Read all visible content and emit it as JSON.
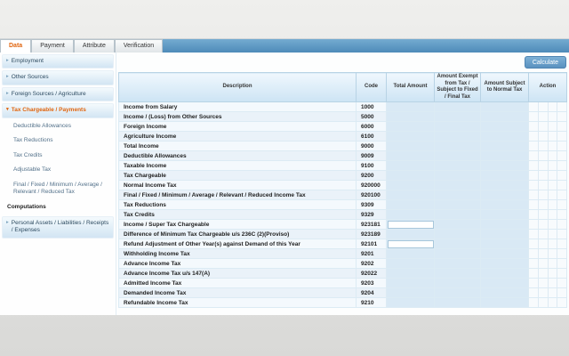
{
  "tabs": [
    {
      "label": "Data",
      "active": true
    },
    {
      "label": "Payment",
      "active": false
    },
    {
      "label": "Attribute",
      "active": false
    },
    {
      "label": "Verification",
      "active": false
    }
  ],
  "sidebar": {
    "items": [
      {
        "label": "Employment",
        "type": "collapsed"
      },
      {
        "label": "Other Sources",
        "type": "collapsed"
      },
      {
        "label": "Foreign Sources / Agriculture",
        "type": "collapsed"
      },
      {
        "label": "Tax Chargeable / Payments",
        "type": "expanded"
      },
      {
        "label": "Deductible Allowances",
        "type": "sub"
      },
      {
        "label": "Tax Reductions",
        "type": "sub"
      },
      {
        "label": "Tax Credits",
        "type": "sub"
      },
      {
        "label": "Adjustable Tax",
        "type": "sub"
      },
      {
        "label": "Final / Fixed / Minimum / Average / Relevant / Reduced Tax",
        "type": "sub"
      },
      {
        "label": "Computations",
        "type": "heading"
      },
      {
        "label": "Personal Assets / Liabilities / Receipts / Expenses",
        "type": "collapsed"
      }
    ]
  },
  "toolbar": {
    "calculate_label": "Calculate"
  },
  "table": {
    "columns": [
      "Description",
      "Code",
      "Total Amount",
      "Amount Exempt from Tax / Subject to Fixed / Final Tax",
      "Amount Subject to Normal Tax",
      "Action"
    ],
    "rows": [
      {
        "description": "Income from Salary",
        "code": "1000",
        "editable": false
      },
      {
        "description": "Income / (Loss) from Other Sources",
        "code": "5000",
        "editable": false
      },
      {
        "description": "Foreign Income",
        "code": "6000",
        "editable": false
      },
      {
        "description": "Agriculture Income",
        "code": "6100",
        "editable": false
      },
      {
        "description": "Total Income",
        "code": "9000",
        "editable": false
      },
      {
        "description": "Deductible Allowances",
        "code": "9009",
        "editable": false
      },
      {
        "description": "Taxable Income",
        "code": "9100",
        "editable": false
      },
      {
        "description": "Tax Chargeable",
        "code": "9200",
        "editable": false
      },
      {
        "description": "Normal Income Tax",
        "code": "920000",
        "editable": false
      },
      {
        "description": "Final / Fixed / Minimum / Average / Relevant / Reduced Income Tax",
        "code": "920100",
        "editable": false
      },
      {
        "description": "Tax Reductions",
        "code": "9309",
        "editable": false
      },
      {
        "description": "Tax Credits",
        "code": "9329",
        "editable": false
      },
      {
        "description": "Income / Super Tax Chargeable",
        "code": "923181",
        "editable": true
      },
      {
        "description": "Difference of Minimum Tax Chargeable u/s 236C (2)(Proviso)",
        "code": "923189",
        "editable": false
      },
      {
        "description": "Refund Adjustment of Other Year(s) against Demand of this Year",
        "code": "92101",
        "editable": true
      },
      {
        "description": "Withholding Income Tax",
        "code": "9201",
        "editable": false
      },
      {
        "description": "Advance Income Tax",
        "code": "9202",
        "editable": false
      },
      {
        "description": "Advance Income Tax u/s 147(A)",
        "code": "92022",
        "editable": false
      },
      {
        "description": "Admitted Income Tax",
        "code": "9203",
        "editable": false
      },
      {
        "description": "Demanded Income Tax",
        "code": "9204",
        "editable": false
      },
      {
        "description": "Refundable Income Tax",
        "code": "9210",
        "editable": false
      }
    ]
  },
  "colors": {
    "accent_orange": "#e0650f",
    "strip_blue": "#5b9ac7",
    "button_blue": "#6b9dc8",
    "readonly_cell_blue": "#d9e9f5",
    "header_gradient_top": "#eff7fd",
    "header_gradient_bottom": "#cde4f4"
  }
}
